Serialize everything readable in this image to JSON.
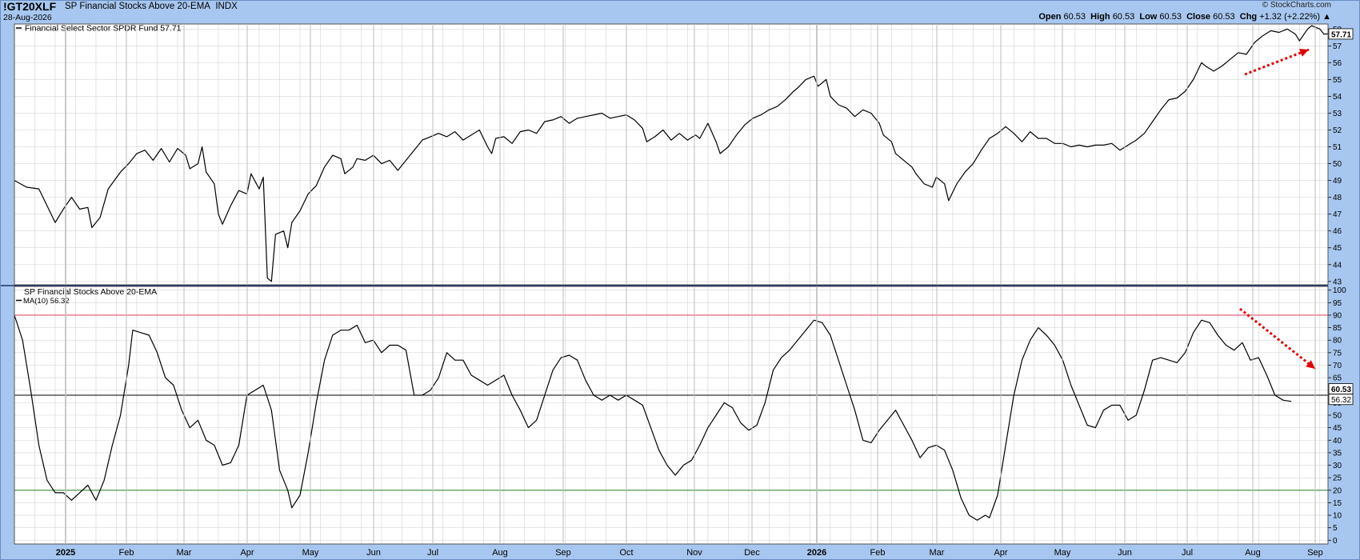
{
  "header": {
    "symbol": "!GT20XLF",
    "description": "SP Financial Stocks Above 20-EMA",
    "exchange": "INDX",
    "date": "28-Aug-2026",
    "credit": "© StockCharts.com",
    "open_label": "Open",
    "open": "60.53",
    "high_label": "High",
    "high": "60.53",
    "low_label": "Low",
    "low": "60.53",
    "close_label": "Close",
    "close": "60.53",
    "chg_label": "Chg",
    "chg": "+1.32 (+2.22%)",
    "chg_arrow": "▲"
  },
  "colors": {
    "header_bg": "#a7c7f0",
    "plot_bg": "#ffffff",
    "grid": "#d3d3d3",
    "price_line": "#000000",
    "overbought_line": "#e0506a",
    "oversold_line": "#3a8a3a",
    "midline": "#000000",
    "arrow": "#e00000"
  },
  "chart_data": [
    {
      "type": "line",
      "panel": "upper",
      "legend": "Financial Select Sector SPDR Fund 57.71",
      "last_value": "57.71",
      "y_ticks": [
        43,
        44,
        45,
        46,
        47,
        48,
        49,
        50,
        51,
        52,
        53,
        54,
        55,
        56,
        57,
        58
      ],
      "ylim": [
        42.8,
        58.3
      ],
      "anchors": [
        [
          0,
          49.0
        ],
        [
          3,
          48.6
        ],
        [
          6,
          48.5
        ],
        [
          8,
          47.5
        ],
        [
          10,
          46.5
        ],
        [
          12,
          47.3
        ],
        [
          14,
          48.0
        ],
        [
          16,
          47.3
        ],
        [
          18,
          47.4
        ],
        [
          19,
          46.2
        ],
        [
          21,
          46.8
        ],
        [
          23,
          48.5
        ],
        [
          26,
          49.5
        ],
        [
          28,
          50.0
        ],
        [
          30,
          50.6
        ],
        [
          32,
          50.8
        ],
        [
          34,
          50.2
        ],
        [
          36,
          50.9
        ],
        [
          38,
          50.1
        ],
        [
          40,
          50.9
        ],
        [
          42,
          50.5
        ],
        [
          43,
          49.7
        ],
        [
          45,
          50.0
        ],
        [
          46,
          51.0
        ],
        [
          47,
          49.5
        ],
        [
          49,
          48.8
        ],
        [
          50,
          47.0
        ],
        [
          51,
          46.4
        ],
        [
          53,
          47.5
        ],
        [
          55,
          48.4
        ],
        [
          57,
          48.2
        ],
        [
          58,
          49.4
        ],
        [
          60,
          48.5
        ],
        [
          61,
          49.2
        ],
        [
          62,
          43.2
        ],
        [
          63,
          43.0
        ],
        [
          64,
          45.8
        ],
        [
          66,
          46.0
        ],
        [
          67,
          45.0
        ],
        [
          68,
          46.5
        ],
        [
          70,
          47.2
        ],
        [
          72,
          48.2
        ],
        [
          74,
          48.7
        ],
        [
          76,
          49.8
        ],
        [
          78,
          50.5
        ],
        [
          80,
          50.3
        ],
        [
          81,
          49.4
        ],
        [
          83,
          49.8
        ],
        [
          84,
          50.3
        ],
        [
          86,
          50.2
        ],
        [
          88,
          50.5
        ],
        [
          90,
          50.0
        ],
        [
          92,
          50.2
        ],
        [
          94,
          49.6
        ],
        [
          96,
          50.2
        ],
        [
          98,
          50.8
        ],
        [
          100,
          51.4
        ],
        [
          102,
          51.6
        ],
        [
          104,
          51.8
        ],
        [
          106,
          51.6
        ],
        [
          108,
          51.9
        ],
        [
          110,
          51.4
        ],
        [
          112,
          51.7
        ],
        [
          114,
          52.0
        ],
        [
          116,
          51.0
        ],
        [
          117,
          50.6
        ],
        [
          118,
          51.5
        ],
        [
          120,
          51.6
        ],
        [
          122,
          51.2
        ],
        [
          124,
          51.9
        ],
        [
          126,
          52.0
        ],
        [
          128,
          51.8
        ],
        [
          130,
          52.5
        ],
        [
          132,
          52.6
        ],
        [
          134,
          52.8
        ],
        [
          136,
          52.4
        ],
        [
          138,
          52.7
        ],
        [
          140,
          52.8
        ],
        [
          142,
          52.9
        ],
        [
          144,
          53.0
        ],
        [
          146,
          52.7
        ],
        [
          148,
          52.8
        ],
        [
          150,
          52.9
        ],
        [
          152,
          52.6
        ],
        [
          154,
          52.1
        ],
        [
          155,
          51.3
        ],
        [
          157,
          51.6
        ],
        [
          159,
          52.0
        ],
        [
          161,
          51.4
        ],
        [
          163,
          51.8
        ],
        [
          165,
          51.4
        ],
        [
          167,
          51.7
        ],
        [
          168,
          51.5
        ],
        [
          170,
          52.4
        ],
        [
          172,
          51.3
        ],
        [
          173,
          50.6
        ],
        [
          175,
          51.0
        ],
        [
          177,
          51.7
        ],
        [
          179,
          52.3
        ],
        [
          181,
          52.7
        ],
        [
          183,
          52.9
        ],
        [
          185,
          53.2
        ],
        [
          187,
          53.4
        ],
        [
          189,
          53.8
        ],
        [
          191,
          54.3
        ],
        [
          192,
          54.5
        ],
        [
          194,
          55.0
        ],
        [
          196,
          55.2
        ],
        [
          197,
          54.6
        ],
        [
          199,
          55.0
        ],
        [
          200,
          54.0
        ],
        [
          202,
          53.5
        ],
        [
          204,
          53.3
        ],
        [
          206,
          52.8
        ],
        [
          208,
          53.2
        ],
        [
          210,
          53.0
        ],
        [
          212,
          52.4
        ],
        [
          213,
          51.7
        ],
        [
          215,
          51.3
        ],
        [
          216,
          50.6
        ],
        [
          218,
          50.2
        ],
        [
          220,
          49.8
        ],
        [
          221,
          49.4
        ],
        [
          223,
          48.8
        ],
        [
          225,
          48.6
        ],
        [
          226,
          49.2
        ],
        [
          228,
          48.8
        ],
        [
          229,
          47.8
        ],
        [
          231,
          48.8
        ],
        [
          233,
          49.5
        ],
        [
          235,
          50.0
        ],
        [
          237,
          50.8
        ],
        [
          239,
          51.5
        ],
        [
          241,
          51.8
        ],
        [
          243,
          52.2
        ],
        [
          245,
          51.8
        ],
        [
          247,
          51.3
        ],
        [
          249,
          51.9
        ],
        [
          251,
          51.5
        ],
        [
          253,
          51.5
        ],
        [
          255,
          51.2
        ],
        [
          257,
          51.2
        ],
        [
          259,
          51.0
        ],
        [
          261,
          51.1
        ],
        [
          263,
          51.0
        ],
        [
          265,
          51.1
        ],
        [
          267,
          51.1
        ],
        [
          269,
          51.2
        ],
        [
          271,
          50.8
        ],
        [
          273,
          51.1
        ],
        [
          275,
          51.4
        ],
        [
          277,
          51.8
        ],
        [
          279,
          52.5
        ],
        [
          281,
          53.2
        ],
        [
          283,
          53.8
        ],
        [
          285,
          53.9
        ],
        [
          287,
          54.3
        ],
        [
          289,
          55.0
        ],
        [
          291,
          56.0
        ],
        [
          292,
          55.8
        ],
        [
          294,
          55.5
        ],
        [
          296,
          55.8
        ],
        [
          298,
          56.2
        ],
        [
          300,
          56.6
        ],
        [
          302,
          56.5
        ],
        [
          304,
          57.2
        ],
        [
          306,
          57.6
        ],
        [
          308,
          57.9
        ],
        [
          310,
          57.8
        ],
        [
          312,
          58.0
        ],
        [
          314,
          57.7
        ],
        [
          315,
          57.3
        ],
        [
          317,
          58.0
        ],
        [
          318,
          58.2
        ],
        [
          320,
          58.0
        ],
        [
          321,
          57.7
        ],
        [
          322,
          57.71
        ]
      ]
    },
    {
      "type": "line",
      "panel": "lower",
      "title": "SP Financial Stocks Above 20-EMA",
      "legend": "MA(10) 56.32",
      "last_value": "60.53",
      "ma_value": "56.32",
      "y_ticks": [
        0,
        5,
        10,
        15,
        20,
        25,
        30,
        35,
        40,
        45,
        50,
        55,
        60,
        65,
        70,
        75,
        80,
        85,
        90,
        95,
        100
      ],
      "ylim": [
        -1.5,
        101.5
      ],
      "reference_lines": [
        90,
        58,
        20
      ],
      "anchors": [
        [
          0,
          90
        ],
        [
          2,
          80
        ],
        [
          4,
          60
        ],
        [
          6,
          38
        ],
        [
          8,
          24
        ],
        [
          10,
          19
        ],
        [
          12,
          19
        ],
        [
          14,
          16
        ],
        [
          16,
          19
        ],
        [
          18,
          22
        ],
        [
          20,
          16
        ],
        [
          22,
          24
        ],
        [
          24,
          38
        ],
        [
          26,
          50
        ],
        [
          28,
          70
        ],
        [
          29,
          84
        ],
        [
          31,
          83
        ],
        [
          33,
          82
        ],
        [
          35,
          75
        ],
        [
          37,
          65
        ],
        [
          39,
          62
        ],
        [
          41,
          52
        ],
        [
          43,
          45
        ],
        [
          45,
          48
        ],
        [
          47,
          40
        ],
        [
          49,
          38
        ],
        [
          51,
          30
        ],
        [
          53,
          31
        ],
        [
          55,
          38
        ],
        [
          57,
          58
        ],
        [
          59,
          60
        ],
        [
          61,
          62
        ],
        [
          63,
          52
        ],
        [
          65,
          28
        ],
        [
          67,
          20
        ],
        [
          68,
          13
        ],
        [
          70,
          18
        ],
        [
          72,
          35
        ],
        [
          74,
          55
        ],
        [
          76,
          72
        ],
        [
          78,
          82
        ],
        [
          80,
          84
        ],
        [
          82,
          84
        ],
        [
          84,
          86
        ],
        [
          86,
          79
        ],
        [
          88,
          80
        ],
        [
          90,
          75
        ],
        [
          92,
          78
        ],
        [
          94,
          78
        ],
        [
          96,
          76
        ],
        [
          98,
          58
        ],
        [
          100,
          58
        ],
        [
          102,
          60
        ],
        [
          104,
          65
        ],
        [
          106,
          75
        ],
        [
          108,
          72
        ],
        [
          110,
          72
        ],
        [
          112,
          66
        ],
        [
          114,
          64
        ],
        [
          116,
          62
        ],
        [
          118,
          64
        ],
        [
          120,
          66
        ],
        [
          122,
          58
        ],
        [
          124,
          52
        ],
        [
          126,
          45
        ],
        [
          128,
          48
        ],
        [
          130,
          58
        ],
        [
          132,
          68
        ],
        [
          134,
          73
        ],
        [
          136,
          74
        ],
        [
          138,
          72
        ],
        [
          140,
          64
        ],
        [
          142,
          58
        ],
        [
          144,
          56
        ],
        [
          146,
          58
        ],
        [
          148,
          56
        ],
        [
          150,
          58
        ],
        [
          152,
          56
        ],
        [
          154,
          54
        ],
        [
          156,
          45
        ],
        [
          158,
          36
        ],
        [
          160,
          30
        ],
        [
          162,
          26
        ],
        [
          164,
          30
        ],
        [
          166,
          32
        ],
        [
          168,
          38
        ],
        [
          170,
          45
        ],
        [
          172,
          50
        ],
        [
          174,
          55
        ],
        [
          176,
          53
        ],
        [
          178,
          47
        ],
        [
          180,
          44
        ],
        [
          182,
          46
        ],
        [
          184,
          55
        ],
        [
          186,
          68
        ],
        [
          188,
          73
        ],
        [
          190,
          76
        ],
        [
          192,
          80
        ],
        [
          194,
          84
        ],
        [
          196,
          88
        ],
        [
          198,
          87
        ],
        [
          200,
          82
        ],
        [
          202,
          72
        ],
        [
          204,
          62
        ],
        [
          206,
          52
        ],
        [
          208,
          40
        ],
        [
          210,
          39
        ],
        [
          212,
          44
        ],
        [
          214,
          48
        ],
        [
          216,
          52
        ],
        [
          218,
          46
        ],
        [
          220,
          40
        ],
        [
          222,
          33
        ],
        [
          224,
          37
        ],
        [
          226,
          38
        ],
        [
          228,
          36
        ],
        [
          230,
          28
        ],
        [
          232,
          17
        ],
        [
          234,
          10
        ],
        [
          236,
          8
        ],
        [
          238,
          10
        ],
        [
          239,
          9
        ],
        [
          241,
          18
        ],
        [
          243,
          38
        ],
        [
          245,
          58
        ],
        [
          247,
          72
        ],
        [
          249,
          80
        ],
        [
          251,
          85
        ],
        [
          253,
          82
        ],
        [
          255,
          78
        ],
        [
          257,
          72
        ],
        [
          259,
          62
        ],
        [
          261,
          54
        ],
        [
          263,
          46
        ],
        [
          265,
          45
        ],
        [
          267,
          52
        ],
        [
          269,
          54
        ],
        [
          271,
          54
        ],
        [
          273,
          48
        ],
        [
          275,
          50
        ],
        [
          277,
          60
        ],
        [
          279,
          72
        ],
        [
          281,
          73
        ],
        [
          283,
          72
        ],
        [
          285,
          71
        ],
        [
          287,
          75
        ],
        [
          289,
          83
        ],
        [
          291,
          88
        ],
        [
          293,
          87
        ],
        [
          295,
          82
        ],
        [
          297,
          78
        ],
        [
          299,
          76
        ],
        [
          301,
          79
        ],
        [
          303,
          72
        ],
        [
          305,
          73
        ],
        [
          307,
          66
        ],
        [
          309,
          58
        ],
        [
          311,
          56
        ],
        [
          313,
          55.5
        ]
      ]
    }
  ],
  "x_axis": {
    "labels": [
      "2025",
      "Feb",
      "Mar",
      "Apr",
      "May",
      "Jun",
      "Jul",
      "Aug",
      "Sep",
      "Oct",
      "Nov",
      "Dec",
      "2026",
      "Feb",
      "Mar",
      "Apr",
      "May",
      "Jun",
      "Jul",
      "Aug",
      "Sep"
    ],
    "bold_labels": [
      "2025",
      "2026"
    ]
  },
  "annotations": [
    "red dotted arrow pointing up on price panel",
    "red dotted arrow pointing down on oscillator panel"
  ]
}
